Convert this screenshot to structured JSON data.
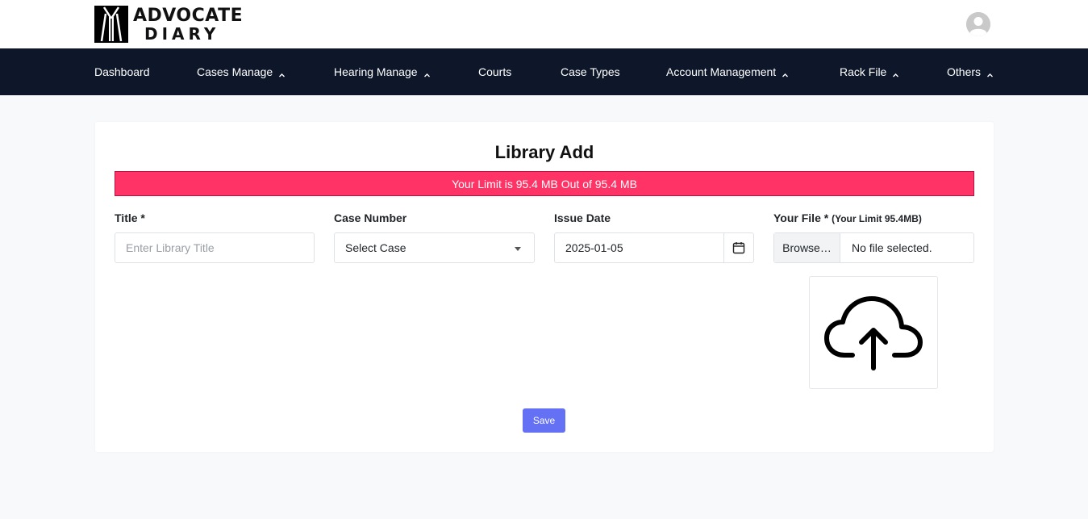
{
  "header": {
    "logo": {
      "line1": "ADVOCATE",
      "line2": "DIARY"
    },
    "avatar_icon": "user-avatar-icon"
  },
  "nav": {
    "items": [
      {
        "label": "Dashboard",
        "has_dropdown": false
      },
      {
        "label": "Cases Manage",
        "has_dropdown": true
      },
      {
        "label": "Hearing Manage",
        "has_dropdown": true
      },
      {
        "label": "Courts",
        "has_dropdown": false
      },
      {
        "label": "Case Types",
        "has_dropdown": false
      },
      {
        "label": "Account Management",
        "has_dropdown": true
      },
      {
        "label": "Rack File",
        "has_dropdown": true
      },
      {
        "label": "Others",
        "has_dropdown": true
      }
    ]
  },
  "form": {
    "title": "Library Add",
    "alert": "Your Limit is 95.4 MB Out of 95.4 MB",
    "title_field": {
      "label": "Title *",
      "placeholder": "Enter Library Title",
      "value": ""
    },
    "case_number": {
      "label": "Case Number",
      "selected": "Select Case"
    },
    "issue_date": {
      "label": "Issue Date",
      "value": "2025-01-05"
    },
    "file": {
      "label": "Your File *",
      "limit_note": "(Your Limit 95.4MB)",
      "browse_label": "Browse…",
      "status": "No file selected."
    },
    "upload_icon": "cloud-upload-icon",
    "save_label": "Save"
  },
  "colors": {
    "navbar_bg": "#0e1729",
    "alert_bg": "#ff3366",
    "save_button": "#6571f4",
    "page_bg": "#f8f9fb"
  }
}
